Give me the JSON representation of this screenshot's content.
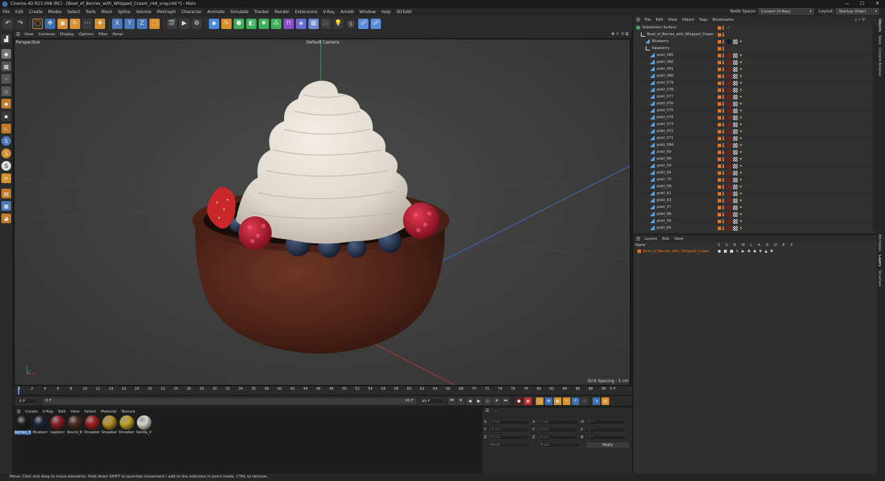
{
  "window": {
    "title": "Cinema 4D R23.008 (RC) - [Bowl_of_Berries_with_Whipped_Cream_c4d_vray.c4d *] - Main",
    "controls": [
      "—",
      "☐",
      "✕"
    ]
  },
  "menubar": {
    "items": [
      "File",
      "Edit",
      "Create",
      "Modes",
      "Select",
      "Tools",
      "Mesh",
      "Spline",
      "Volume",
      "MoGraph",
      "Character",
      "Animate",
      "Simulate",
      "Tracker",
      "Render",
      "Extensions",
      "V-Ray",
      "Arnold",
      "Window",
      "Help",
      "3DToAll"
    ],
    "node_space_label": "Node Space:",
    "node_space_value": "Current (V-Ray)",
    "layout_label": "Layout:",
    "layout_value": "Startup (User)"
  },
  "viewport": {
    "menu": [
      "View",
      "Cameras",
      "Display",
      "Options",
      "Filter",
      "Panel"
    ],
    "label": "Perspective",
    "camera": "Default Camera",
    "grid_spacing": "Grid Spacing : 5 cm"
  },
  "timeline": {
    "ticks": [
      "0",
      "2",
      "4",
      "6",
      "8",
      "10",
      "12",
      "14",
      "16",
      "18",
      "20",
      "22",
      "24",
      "26",
      "28",
      "30",
      "32",
      "34",
      "36",
      "38",
      "40",
      "42",
      "44",
      "46",
      "48",
      "50",
      "52",
      "54",
      "56",
      "58",
      "60",
      "62",
      "64",
      "66",
      "68",
      "70",
      "72",
      "74",
      "76",
      "78",
      "80",
      "82",
      "84",
      "86",
      "88",
      "90"
    ],
    "current_frame": "0 F"
  },
  "transport": {
    "start": "0 F",
    "range_start": "0 F",
    "range_end": "90 F",
    "end": "90 F"
  },
  "materials": {
    "menu": [
      "Create",
      "V-Ray",
      "Edit",
      "View",
      "Select",
      "Material",
      "Texture"
    ],
    "items": [
      {
        "name": "berries_B",
        "color": "#1b1b20",
        "selected": true
      },
      {
        "name": "Blueberr",
        "color": "#1a2438"
      },
      {
        "name": "raspberr",
        "color": "#8e1c26"
      },
      {
        "name": "Round_B",
        "color": "#4a2b22"
      },
      {
        "name": "Strawber",
        "color": "#a41d1d"
      },
      {
        "name": "Strawber",
        "color": "#b8901e"
      },
      {
        "name": "Strawber",
        "color": "#c3a024"
      },
      {
        "name": "Vanilla_V",
        "color": "#d8d5cc"
      }
    ]
  },
  "coordinates": {
    "rows": [
      {
        "a": "X",
        "v1": "0 cm",
        "b": "X",
        "v2": "0 cm",
        "c": "H",
        "v3": "0 °"
      },
      {
        "a": "Y",
        "v1": "0 cm",
        "b": "Y",
        "v2": "0 cm",
        "c": "P",
        "v3": "0 °"
      },
      {
        "a": "Z",
        "v1": "0 cm",
        "b": "Z",
        "v2": "0 cm",
        "c": "B",
        "v3": "0 °"
      }
    ],
    "mode": "World",
    "scale": "Scale",
    "apply": "Apply"
  },
  "object_manager": {
    "menu": [
      "File",
      "Edit",
      "View",
      "Object",
      "Tags",
      "Bookmarks"
    ],
    "objects": [
      {
        "name": "Subdivision Surface",
        "depth": 0,
        "kind": "subdiv"
      },
      {
        "name": "Bowl_of_Berries_with_Whipped_Cream",
        "depth": 1,
        "kind": "null"
      },
      {
        "name": "Blueberry",
        "depth": 2,
        "kind": "mesh",
        "tags": "blue"
      },
      {
        "name": "Raspberry",
        "depth": 2,
        "kind": "null"
      },
      {
        "name": "pistil_085",
        "depth": 3,
        "kind": "mesh",
        "tags": "rasp"
      },
      {
        "name": "pistil_082",
        "depth": 3,
        "kind": "mesh",
        "tags": "rasp"
      },
      {
        "name": "pistil_081",
        "depth": 3,
        "kind": "mesh",
        "tags": "rasp"
      },
      {
        "name": "pistil_080",
        "depth": 3,
        "kind": "mesh",
        "tags": "rasp"
      },
      {
        "name": "pistil_079",
        "depth": 3,
        "kind": "mesh",
        "tags": "rasp"
      },
      {
        "name": "pistil_078",
        "depth": 3,
        "kind": "mesh",
        "tags": "rasp"
      },
      {
        "name": "pistil_077",
        "depth": 3,
        "kind": "mesh",
        "tags": "rasp"
      },
      {
        "name": "pistil_076",
        "depth": 3,
        "kind": "mesh",
        "tags": "rasp"
      },
      {
        "name": "pistil_075",
        "depth": 3,
        "kind": "mesh",
        "tags": "rasp"
      },
      {
        "name": "pistil_074",
        "depth": 3,
        "kind": "mesh",
        "tags": "rasp"
      },
      {
        "name": "pistil_073",
        "depth": 3,
        "kind": "mesh",
        "tags": "rasp"
      },
      {
        "name": "pistil_072",
        "depth": 3,
        "kind": "mesh",
        "tags": "rasp"
      },
      {
        "name": "pistil_071",
        "depth": 3,
        "kind": "mesh",
        "tags": "rasp"
      },
      {
        "name": "pistil_084",
        "depth": 3,
        "kind": "mesh",
        "tags": "rasp"
      },
      {
        "name": "pistil_69",
        "depth": 3,
        "kind": "mesh",
        "tags": "rasp"
      },
      {
        "name": "pistil_68",
        "depth": 3,
        "kind": "mesh",
        "tags": "rasp"
      },
      {
        "name": "pistil_59",
        "depth": 3,
        "kind": "mesh",
        "tags": "rasp"
      },
      {
        "name": "pistil_64",
        "depth": 3,
        "kind": "mesh",
        "tags": "rasp"
      },
      {
        "name": "pistil_70",
        "depth": 3,
        "kind": "mesh",
        "tags": "rasp"
      },
      {
        "name": "pistil_58",
        "depth": 3,
        "kind": "mesh",
        "tags": "rasp"
      },
      {
        "name": "pistil_61",
        "depth": 3,
        "kind": "mesh",
        "tags": "rasp"
      },
      {
        "name": "pistil_63",
        "depth": 3,
        "kind": "mesh",
        "tags": "rasp"
      },
      {
        "name": "pistil_57",
        "depth": 3,
        "kind": "mesh",
        "tags": "rasp"
      },
      {
        "name": "pistil_66",
        "depth": 3,
        "kind": "mesh",
        "tags": "rasp"
      },
      {
        "name": "pistil_56",
        "depth": 3,
        "kind": "mesh",
        "tags": "rasp"
      },
      {
        "name": "pistil_65",
        "depth": 3,
        "kind": "mesh",
        "tags": "rasp"
      }
    ]
  },
  "layers": {
    "menu": [
      "Layers",
      "Edit",
      "View"
    ],
    "header_name": "Name",
    "header_flags": "S V R M L A G D E X",
    "rows": [
      {
        "name": "Bowl_of_Berries_with_Whipped_Cream"
      }
    ]
  },
  "right_tabs": [
    "Objects",
    "Takes",
    "Content Browser",
    "Attributes",
    "Layers",
    "Structure"
  ],
  "status": "Move: Click and drag to move elements. Hold down SHIFT to quantize movement / add to the selection in point mode, CTRL to remove.",
  "colors": {
    "accent": "#e0772b",
    "selection": "#3b6fb0",
    "bowl": "#5a2a1f",
    "cream": "#e6e0d6"
  }
}
